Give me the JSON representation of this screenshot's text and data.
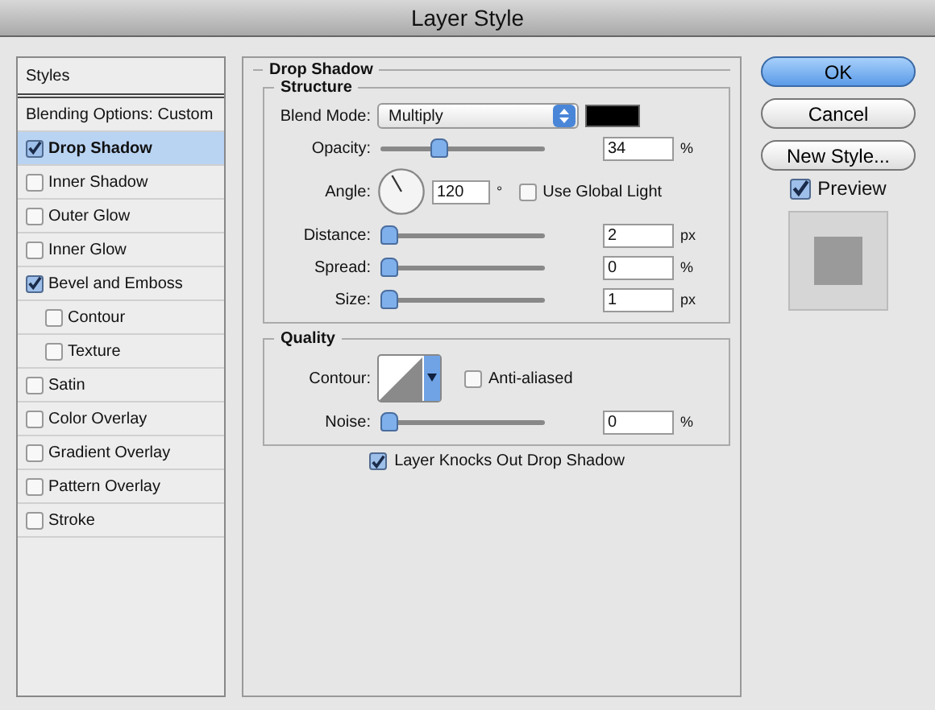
{
  "window": {
    "title": "Layer Style"
  },
  "sidebar": {
    "header": "Styles",
    "blending_options": "Blending Options: Custom",
    "items": [
      {
        "label": "Drop Shadow",
        "checked": true,
        "selected": true
      },
      {
        "label": "Inner Shadow",
        "checked": false,
        "selected": false
      },
      {
        "label": "Outer Glow",
        "checked": false,
        "selected": false
      },
      {
        "label": "Inner Glow",
        "checked": false,
        "selected": false
      },
      {
        "label": "Bevel and Emboss",
        "checked": true,
        "selected": false,
        "children": [
          {
            "label": "Contour",
            "checked": false,
            "selected": false
          },
          {
            "label": "Texture",
            "checked": false,
            "selected": false
          }
        ]
      },
      {
        "label": "Satin",
        "checked": false,
        "selected": false
      },
      {
        "label": "Color Overlay",
        "checked": false,
        "selected": false
      },
      {
        "label": "Gradient Overlay",
        "checked": false,
        "selected": false
      },
      {
        "label": "Pattern Overlay",
        "checked": false,
        "selected": false
      },
      {
        "label": "Stroke",
        "checked": false,
        "selected": false
      }
    ]
  },
  "panel": {
    "title": "Drop Shadow",
    "structure": {
      "title": "Structure",
      "blend_mode_label": "Blend Mode:",
      "blend_mode": "Multiply",
      "rows": [
        {
          "kind": "slider",
          "label": "Opacity:",
          "level": 0.34,
          "value": "34",
          "unit": "%"
        },
        {
          "kind": "angle",
          "label": "Angle:",
          "value": "120",
          "unit": "°",
          "checkbox": {
            "label": "Use Global Light",
            "checked": false
          }
        },
        {
          "kind": "slider",
          "label": "Distance:",
          "level": 0,
          "value": "2",
          "unit": "px"
        },
        {
          "kind": "slider",
          "label": "Spread:",
          "level": 0,
          "value": "0",
          "unit": "%"
        },
        {
          "kind": "slider",
          "label": "Size:",
          "level": 0,
          "value": "1",
          "unit": "px"
        }
      ]
    },
    "quality": {
      "title": "Quality",
      "contour_label": "Contour:",
      "anti_aliased": {
        "label": "Anti-aliased",
        "checked": false
      },
      "rows": [
        {
          "kind": "slider",
          "label": "Noise:",
          "level": 0,
          "value": "0",
          "unit": "%"
        }
      ]
    },
    "knockout": {
      "label": "Layer Knocks Out Drop Shadow",
      "checked": true
    }
  },
  "buttons": [
    {
      "label": "OK",
      "primary": true
    },
    {
      "label": "Cancel",
      "primary": false
    },
    {
      "label": "New Style...",
      "primary": false
    }
  ],
  "preview": {
    "label": "Preview",
    "checked": true
  }
}
